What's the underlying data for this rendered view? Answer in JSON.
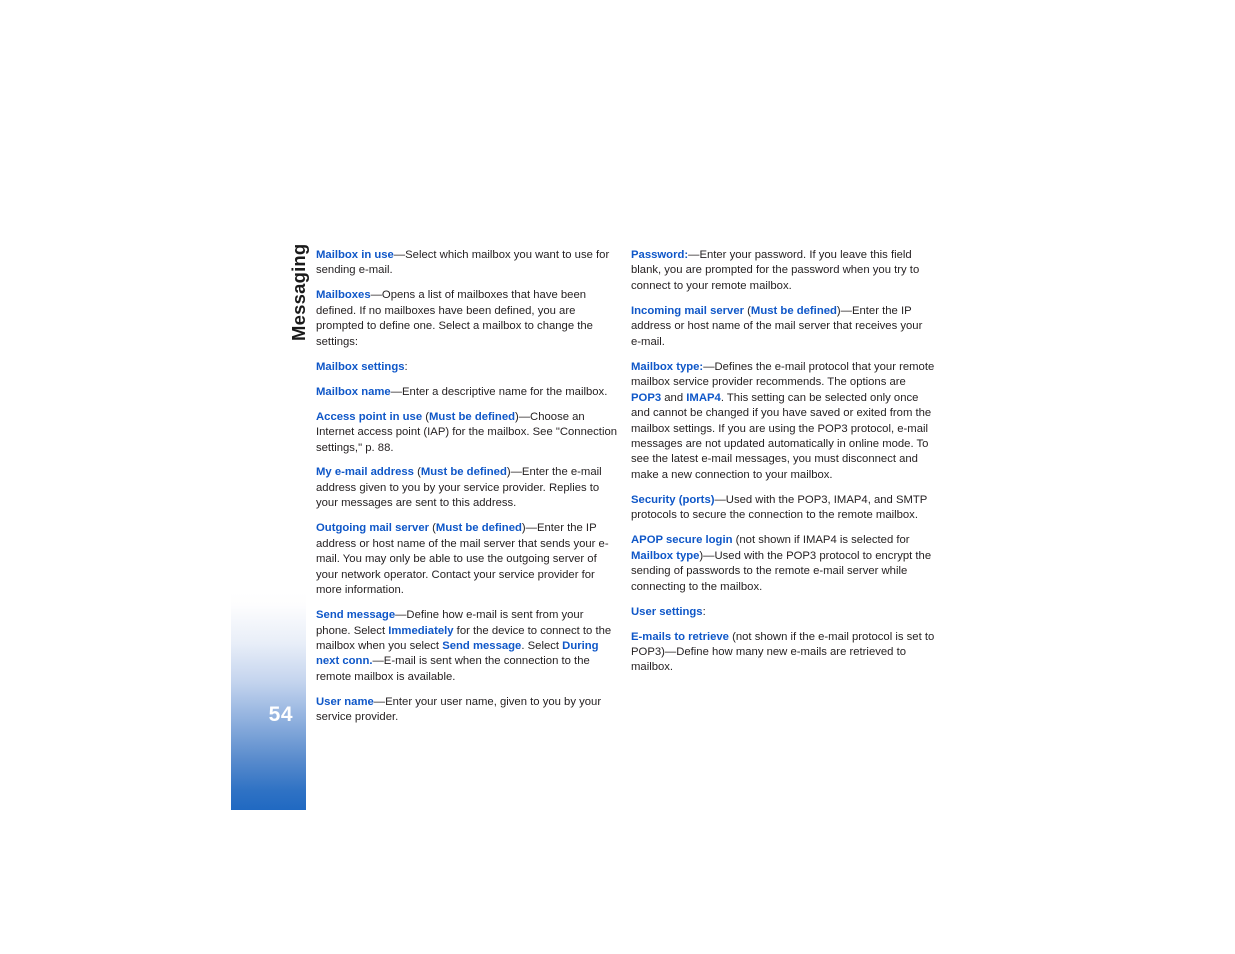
{
  "page": {
    "chapter_label": "Messaging",
    "page_number": "54",
    "accent_blue": "#0f57c8",
    "sidebar_gradient_end": "#2069c2"
  },
  "columns": {
    "left": [
      {
        "id": "mailbox-in-use",
        "runs": [
          {
            "t": "kw",
            "s": "Mailbox in use"
          },
          {
            "t": "pl",
            "s": "—Select which mailbox you want to use for sending e-mail."
          }
        ]
      },
      {
        "id": "mailboxes",
        "runs": [
          {
            "t": "kw",
            "s": "Mailboxes"
          },
          {
            "t": "pl",
            "s": "—Opens a list of mailboxes that have been defined. If no mailboxes have been defined, you are prompted to define one. Select a mailbox to change the settings:"
          }
        ]
      },
      {
        "id": "mailbox-settings",
        "runs": [
          {
            "t": "kw",
            "s": "Mailbox settings"
          },
          {
            "t": "pl",
            "s": ":"
          }
        ]
      },
      {
        "id": "mailbox-name",
        "runs": [
          {
            "t": "kw",
            "s": "Mailbox name"
          },
          {
            "t": "pl",
            "s": "—Enter a descriptive name for the mailbox."
          }
        ]
      },
      {
        "id": "access-point-in-use",
        "runs": [
          {
            "t": "kw",
            "s": "Access point in use"
          },
          {
            "t": "pl",
            "s": " ("
          },
          {
            "t": "kw",
            "s": "Must be defined"
          },
          {
            "t": "pl",
            "s": ")—Choose an Internet access point (IAP) for the mailbox. See \"Connection settings,\" p. 88."
          }
        ]
      },
      {
        "id": "my-email-address",
        "runs": [
          {
            "t": "kw",
            "s": "My e-mail address"
          },
          {
            "t": "pl",
            "s": " ("
          },
          {
            "t": "kw",
            "s": "Must be defined"
          },
          {
            "t": "pl",
            "s": ")—Enter the e-mail address given to you by your service provider. Replies to your messages are sent to this address."
          }
        ]
      },
      {
        "id": "outgoing-mail-server",
        "runs": [
          {
            "t": "kw",
            "s": "Outgoing mail server"
          },
          {
            "t": "pl",
            "s": " ("
          },
          {
            "t": "kw",
            "s": "Must be defined"
          },
          {
            "t": "pl",
            "s": ")—Enter the IP address or host name of the mail server that sends your e-mail. You may only be able to use the outgoing server of your network operator. Contact your service provider for more information."
          }
        ]
      },
      {
        "id": "send-message",
        "runs": [
          {
            "t": "kw",
            "s": "Send message"
          },
          {
            "t": "pl",
            "s": "—Define how e-mail is sent from your phone. Select "
          },
          {
            "t": "kw",
            "s": "Immediately"
          },
          {
            "t": "pl",
            "s": " for the device to connect to the mailbox when you select "
          },
          {
            "t": "kw",
            "s": "Send message"
          },
          {
            "t": "pl",
            "s": ". Select "
          },
          {
            "t": "kw",
            "s": "During next conn."
          },
          {
            "t": "pl",
            "s": "—E-mail is sent when the connection to the remote mailbox is available."
          }
        ]
      },
      {
        "id": "user-name",
        "runs": [
          {
            "t": "kw",
            "s": "User name"
          },
          {
            "t": "pl",
            "s": "—Enter your user name, given to you by your service provider."
          }
        ]
      }
    ],
    "right": [
      {
        "id": "password",
        "runs": [
          {
            "t": "kw",
            "s": "Password:"
          },
          {
            "t": "pl",
            "s": "—Enter your password. If you leave this field blank, you are prompted for the password when you try to connect to your remote mailbox."
          }
        ]
      },
      {
        "id": "incoming-mail-server",
        "runs": [
          {
            "t": "kw",
            "s": "Incoming mail server"
          },
          {
            "t": "pl",
            "s": " ("
          },
          {
            "t": "kw",
            "s": "Must be defined"
          },
          {
            "t": "pl",
            "s": ")—Enter the IP address or host name of the mail server that receives your e-mail."
          }
        ]
      },
      {
        "id": "mailbox-type",
        "runs": [
          {
            "t": "kw",
            "s": "Mailbox type:"
          },
          {
            "t": "pl",
            "s": "—Defines the e-mail protocol that your remote mailbox service provider recommends. The options are "
          },
          {
            "t": "kw",
            "s": "POP3"
          },
          {
            "t": "pl",
            "s": " and "
          },
          {
            "t": "kw",
            "s": "IMAP4"
          },
          {
            "t": "pl",
            "s": ". This setting can be selected only once and cannot be changed if you have saved or exited from the mailbox settings. If you are using the POP3 protocol, e-mail messages are not updated automatically in online mode. To see the latest e-mail messages, you must disconnect and make a new connection to your mailbox."
          }
        ]
      },
      {
        "id": "security-ports",
        "runs": [
          {
            "t": "kw",
            "s": "Security (ports)"
          },
          {
            "t": "pl",
            "s": "—Used with the POP3, IMAP4, and SMTP protocols to secure the connection to the remote mailbox."
          }
        ]
      },
      {
        "id": "apop-secure-login",
        "runs": [
          {
            "t": "kw",
            "s": "APOP secure login"
          },
          {
            "t": "pl",
            "s": " (not shown if IMAP4 is selected for "
          },
          {
            "t": "kw",
            "s": "Mailbox type"
          },
          {
            "t": "pl",
            "s": ")—Used with the POP3 protocol to encrypt the sending of passwords to the remote e-mail server while connecting to the mailbox."
          }
        ]
      },
      {
        "id": "user-settings",
        "runs": [
          {
            "t": "kw",
            "s": "User settings"
          },
          {
            "t": "pl",
            "s": ":"
          }
        ]
      },
      {
        "id": "emails-to-retrieve",
        "runs": [
          {
            "t": "kw",
            "s": "E-mails to retrieve"
          },
          {
            "t": "pl",
            "s": " (not shown if the e-mail protocol is set to POP3)—Define how many new e-mails are retrieved to mailbox."
          }
        ]
      }
    ]
  }
}
